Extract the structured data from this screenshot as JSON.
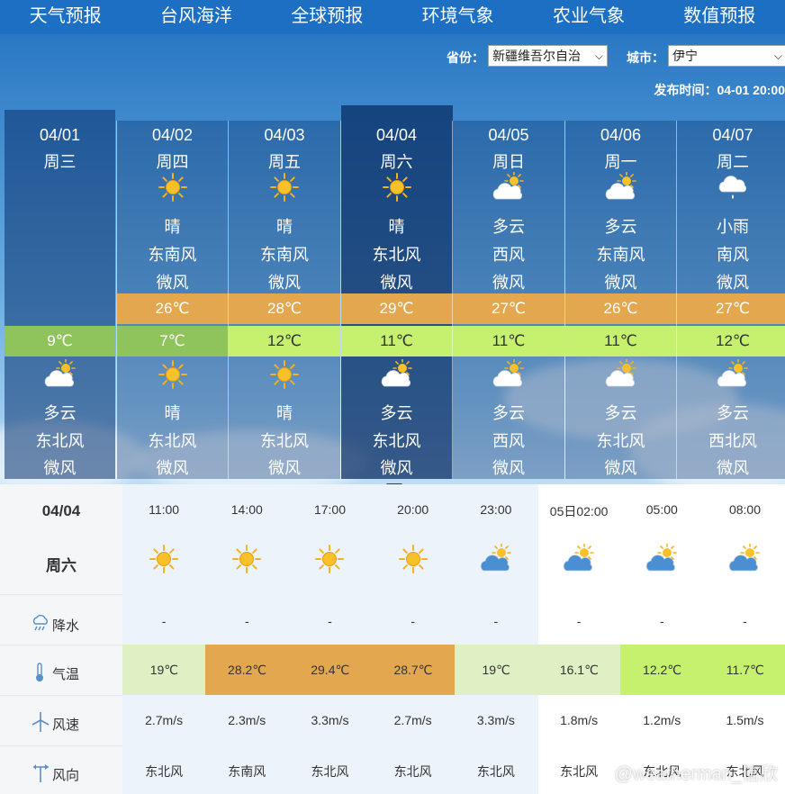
{
  "nav": [
    "天气预报",
    "台风海洋",
    "全球预报",
    "环境气象",
    "农业气象",
    "数值预报"
  ],
  "filters": {
    "province_label": "省份：",
    "province_value": "新疆维吾尔自治",
    "city_label": "城市：",
    "city_value": "伊宁"
  },
  "publish_time": "发布时间：04-01 20:00",
  "days": [
    {
      "date": "04/01",
      "weekday": "周三",
      "day_weather": "",
      "day_wind": "",
      "day_level": "",
      "day_icon": "",
      "high": "",
      "low": "9℃",
      "night_icon": "cloudy-sun-icon",
      "night_weather": "多云",
      "night_wind": "东北风",
      "night_level": "微风"
    },
    {
      "date": "04/02",
      "weekday": "周四",
      "day_icon": "sun-icon",
      "day_weather": "晴",
      "day_wind": "东南风",
      "day_level": "微风",
      "high": "26℃",
      "low": "7℃",
      "night_icon": "sun-icon",
      "night_weather": "晴",
      "night_wind": "东北风",
      "night_level": "微风"
    },
    {
      "date": "04/03",
      "weekday": "周五",
      "day_icon": "sun-icon",
      "day_weather": "晴",
      "day_wind": "东南风",
      "day_level": "微风",
      "high": "28℃",
      "low": "12℃",
      "night_icon": "sun-icon",
      "night_weather": "晴",
      "night_wind": "东北风",
      "night_level": "微风"
    },
    {
      "date": "04/04",
      "weekday": "周六",
      "day_icon": "sun-icon",
      "day_weather": "晴",
      "day_wind": "东北风",
      "day_level": "微风",
      "high": "29℃",
      "low": "11℃",
      "night_icon": "cloudy-sun-icon",
      "night_weather": "多云",
      "night_wind": "东北风",
      "night_level": "微风"
    },
    {
      "date": "04/05",
      "weekday": "周日",
      "day_icon": "cloudy-sun-icon",
      "day_weather": "多云",
      "day_wind": "西风",
      "day_level": "微风",
      "high": "27℃",
      "low": "11℃",
      "night_icon": "cloudy-sun-icon",
      "night_weather": "多云",
      "night_wind": "西风",
      "night_level": "微风"
    },
    {
      "date": "04/06",
      "weekday": "周一",
      "day_icon": "cloudy-sun-icon",
      "day_weather": "多云",
      "day_wind": "东南风",
      "day_level": "微风",
      "high": "26℃",
      "low": "11℃",
      "night_icon": "cloudy-sun-icon",
      "night_weather": "多云",
      "night_wind": "东北风",
      "night_level": "微风"
    },
    {
      "date": "04/07",
      "weekday": "周二",
      "day_icon": "light-rain-icon",
      "day_weather": "小雨",
      "day_wind": "南风",
      "day_level": "微风",
      "high": "27℃",
      "low": "12℃",
      "night_icon": "cloudy-sun-icon",
      "night_weather": "多云",
      "night_wind": "西北风",
      "night_level": "微风"
    }
  ],
  "hourly": {
    "date": "04/04",
    "weekday": "周六",
    "labels": {
      "precip": "降水",
      "temp": "气温",
      "speed": "风速",
      "dir": "风向"
    },
    "hours": [
      {
        "time": "11:00",
        "icon": "sun-icon",
        "precip": "-",
        "temp": "19℃",
        "speed": "2.7m/s",
        "dir": "东北风",
        "temp_color": "#dff0c4"
      },
      {
        "time": "14:00",
        "icon": "sun-icon",
        "precip": "-",
        "temp": "28.2℃",
        "speed": "2.3m/s",
        "dir": "东南风",
        "temp_color": "#e3a84f"
      },
      {
        "time": "17:00",
        "icon": "sun-icon",
        "precip": "-",
        "temp": "29.4℃",
        "speed": "3.3m/s",
        "dir": "东北风",
        "temp_color": "#e3a84f"
      },
      {
        "time": "20:00",
        "icon": "sun-icon",
        "precip": "-",
        "temp": "28.7℃",
        "speed": "2.7m/s",
        "dir": "东北风",
        "temp_color": "#e3a84f"
      },
      {
        "time": "23:00",
        "icon": "cloudy-sun-icon",
        "precip": "-",
        "temp": "19℃",
        "speed": "3.3m/s",
        "dir": "东北风",
        "temp_color": "#dff0c4"
      },
      {
        "time": "05日02:00",
        "icon": "cloudy-sun-icon",
        "precip": "-",
        "temp": "16.1℃",
        "speed": "1.8m/s",
        "dir": "东北风",
        "temp_color": "#dff0c4"
      },
      {
        "time": "05:00",
        "icon": "cloudy-sun-icon",
        "precip": "-",
        "temp": "12.2℃",
        "speed": "1.2m/s",
        "dir": "东北风",
        "temp_color": "#c6f16f"
      },
      {
        "time": "08:00",
        "icon": "cloudy-sun-icon",
        "precip": "-",
        "temp": "11.7℃",
        "speed": "1.5m/s",
        "dir": "东北风",
        "temp_color": "#c6f16f"
      }
    ]
  },
  "watermark": "@weatherman_信欣"
}
